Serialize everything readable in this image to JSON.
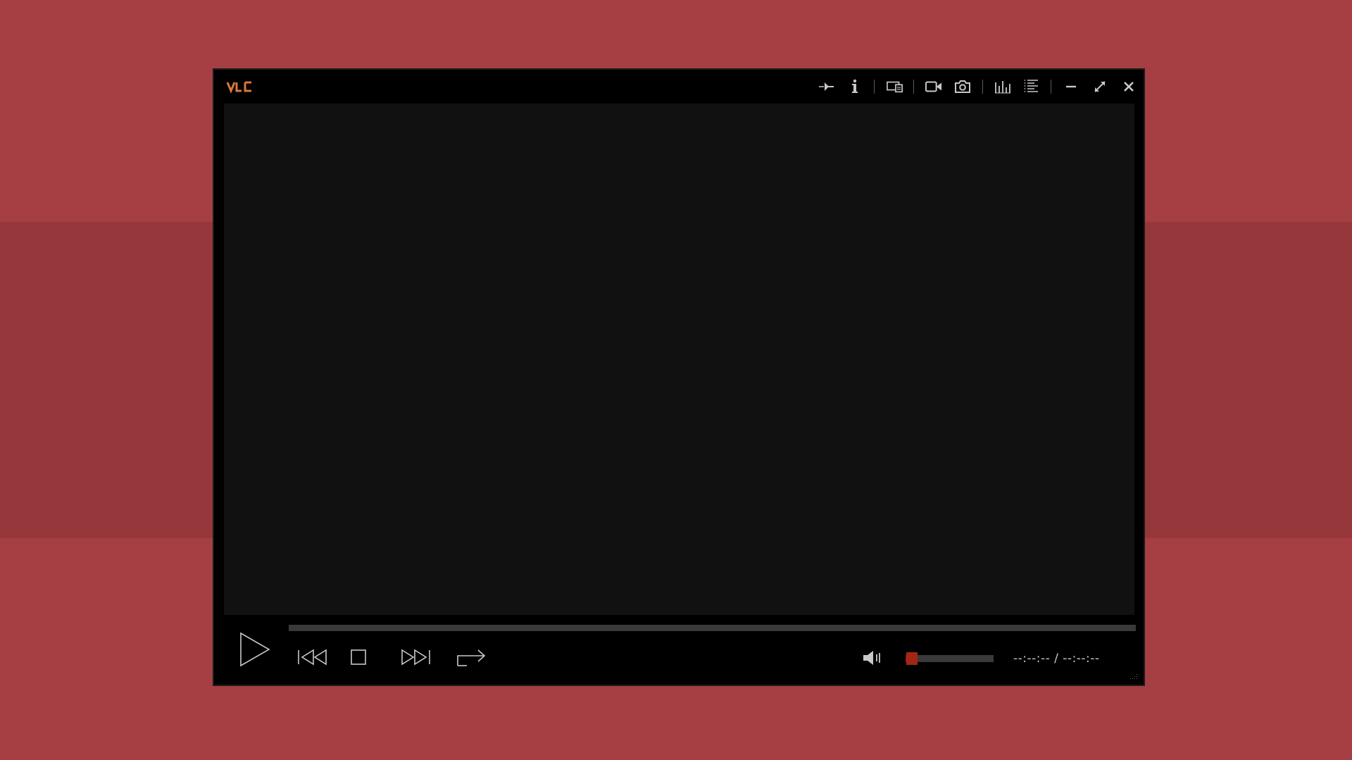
{
  "colors": {
    "background": "#a63f43",
    "background_band": "#96373b",
    "window": "#000000",
    "video_area": "#111111",
    "accent": "#d9783a",
    "volume": "#a22616",
    "icon": "#c8c8c8"
  },
  "titlebar": {
    "logo": "VLC",
    "icons": [
      "pin-icon",
      "info-icon",
      "media-sources-icon",
      "record-icon",
      "snapshot-icon",
      "equalizer-icon",
      "playlist-icon",
      "minimize-icon",
      "maximize-icon",
      "close-icon"
    ]
  },
  "controls": {
    "icons": [
      "play-icon",
      "previous-icon",
      "stop-icon",
      "next-icon",
      "loop-icon",
      "speaker-icon"
    ],
    "seek_position": 0,
    "volume_level": 0.07
  },
  "time": {
    "display": "--:--:-- / --:--:--"
  }
}
